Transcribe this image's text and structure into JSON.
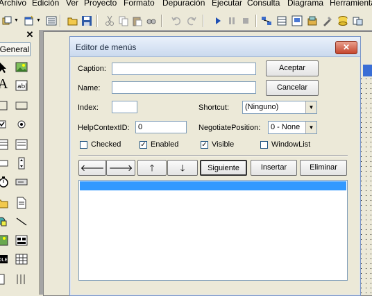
{
  "menubar": {
    "items": [
      "Archivo",
      "Edición",
      "Ver",
      "Proyecto",
      "Formato",
      "Depuración",
      "Ejecutar",
      "Consulta",
      "Diagrama",
      "Herramientas"
    ]
  },
  "toolbox": {
    "close_glyph": "✕",
    "tab_label": "General"
  },
  "dialog": {
    "title": "Editor de menús",
    "close_glyph": "✕",
    "caption_label": "Caption:",
    "caption_value": "",
    "name_label": "Name:",
    "name_value": "",
    "index_label": "Index:",
    "index_value": "",
    "helpcontextid_label": "HelpContextID:",
    "helpcontextid_value": "0",
    "shortcut_label": "Shortcut:",
    "shortcut_value": "(Ninguno)",
    "negotiate_label": "NegotiatePosition:",
    "negotiate_value": "0 - None",
    "accept_button": "Aceptar",
    "cancel_button": "Cancelar",
    "checkboxes": {
      "checked": {
        "label": "Checked",
        "state": false
      },
      "enabled": {
        "label": "Enabled",
        "state": true
      },
      "visible": {
        "label": "Visible",
        "state": true
      },
      "windowlist": {
        "label": "WindowList",
        "state": false
      }
    },
    "nav_buttons": {
      "left": "🡐",
      "right": "🡒",
      "up": "🡑",
      "down": "🡓"
    },
    "next_button": "Siguiente",
    "insert_button": "Insertar",
    "delete_button": "Eliminar",
    "check_glyph": "✓",
    "dropdown_glyph": "▼"
  },
  "colors": {
    "selection": "#3399ff",
    "titlebar": "#cad9ee",
    "close": "#c5452d"
  }
}
